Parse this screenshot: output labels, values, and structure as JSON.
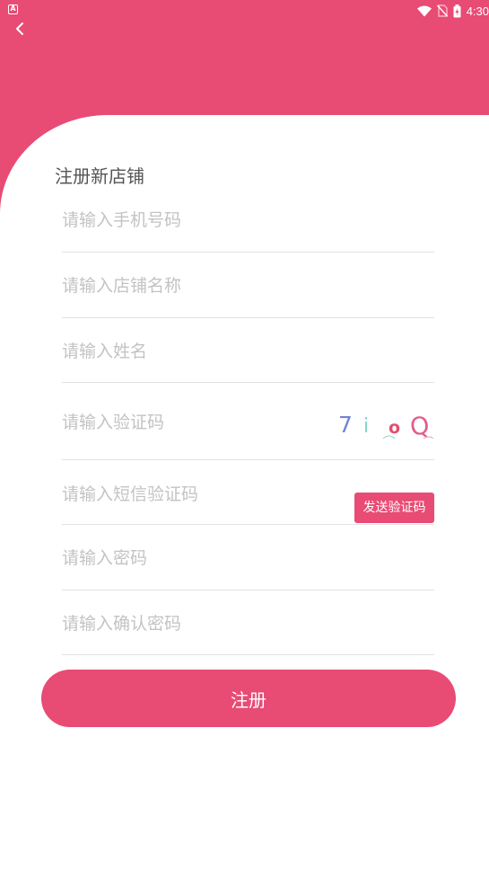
{
  "status_bar": {
    "time": "4:30",
    "icons": [
      "notification-a-icon",
      "wifi-icon",
      "no-sim-icon",
      "battery-charging-icon"
    ]
  },
  "colors": {
    "accent": "#e84b74",
    "placeholder": "#c3c3c3",
    "divider": "#e2e2e2",
    "title": "#555555"
  },
  "header": {
    "back_icon": "chevron-left-icon"
  },
  "form": {
    "title": "注册新店铺",
    "phone_placeholder": "请输入手机号码",
    "store_name_placeholder": "请输入店铺名称",
    "name_placeholder": "请输入姓名",
    "captcha_placeholder": "请输入验证码",
    "captcha_chars": [
      "7",
      "i",
      "o",
      "Q"
    ],
    "sms_code_placeholder": "请输入短信验证码",
    "send_code_label": "发送验证码",
    "password_placeholder": "请输入密码",
    "confirm_password_placeholder": "请输入确认密码",
    "register_label": "注册"
  }
}
